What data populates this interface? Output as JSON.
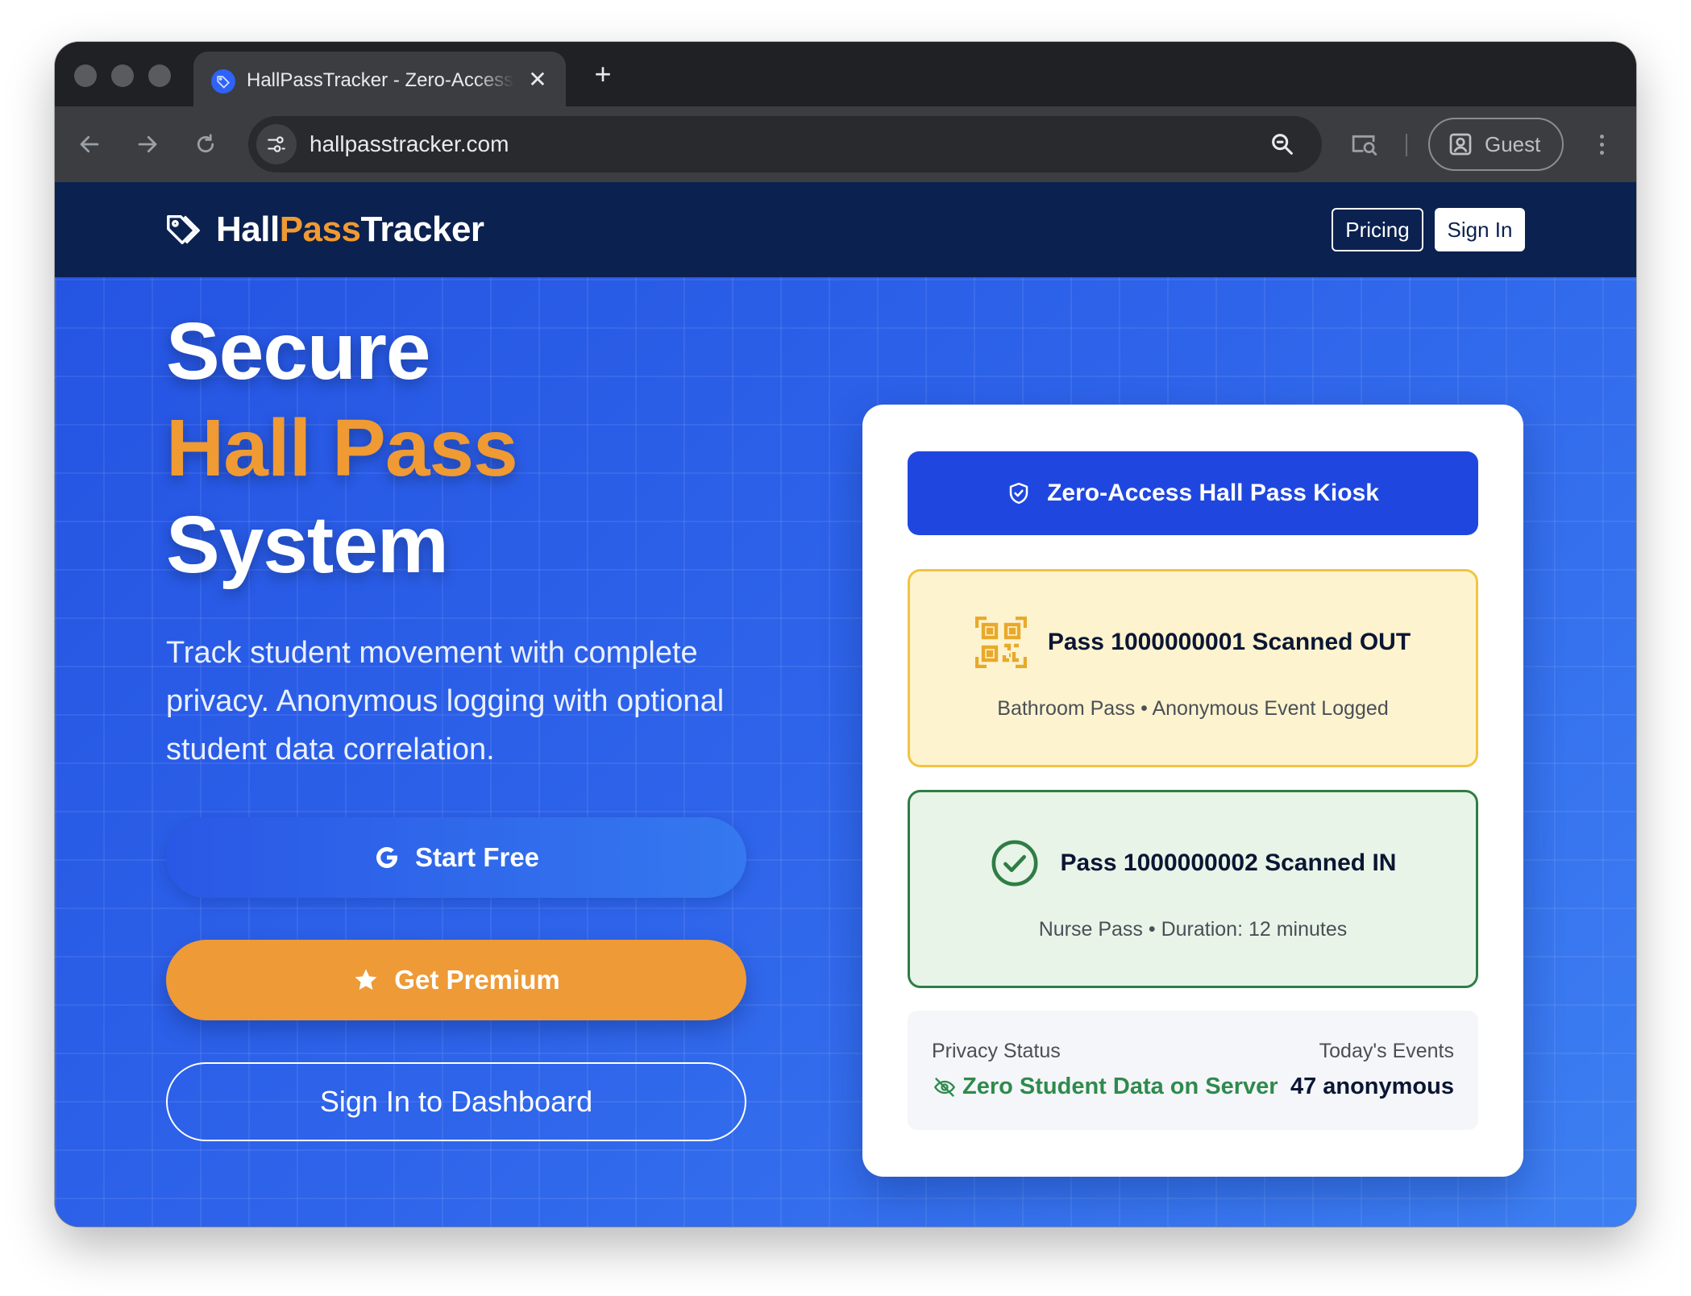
{
  "browser": {
    "tab_title": "HallPassTracker - Zero-Access Hall Pass Kiosk",
    "tab_close_symbol": "✕",
    "new_tab_symbol": "+",
    "url": "hallpasstracker.com",
    "profile_label": "Guest",
    "icons": [
      "back-arrow-icon",
      "forward-arrow-icon",
      "reload-icon",
      "site-info-icon",
      "zoom-search-icon",
      "cast-icon",
      "profile-icon",
      "more-menu-icon"
    ]
  },
  "header": {
    "logo_part1": "Hall",
    "logo_part2": "Pass",
    "logo_part3": "Tracker",
    "pricing_label": "Pricing",
    "signin_label": "Sign In"
  },
  "hero": {
    "title_line1": "Secure",
    "title_line2": "Hall Pass",
    "title_line3": "System",
    "description": "Track student movement with complete privacy. Anonymous logging with optional student data correlation.",
    "start_label": "Start Free",
    "premium_label": "Get Premium",
    "dashboard_label": "Sign In to Dashboard"
  },
  "kiosk": {
    "title": "Zero-Access Hall Pass Kiosk",
    "events": [
      {
        "title": "Pass 1000000001 Scanned OUT",
        "subtitle": "Bathroom Pass • Anonymous Event Logged",
        "icon": "qr-code-icon"
      },
      {
        "title": "Pass 1000000002 Scanned IN",
        "subtitle": "Nurse Pass • Duration: 12 minutes",
        "icon": "check-circle-icon"
      }
    ],
    "privacy_label": "Privacy Status",
    "privacy_value": "Zero Student Data on Server",
    "events_label": "Today's Events",
    "events_value": "47 anonymous"
  },
  "colors": {
    "header_navy": "#0b2150",
    "hero_blue": "#2e64ea",
    "accent_orange": "#ee9a37",
    "kiosk_blue": "#1f47e0",
    "success_green": "#2f8a4c",
    "warning_yellow": "#f1c442"
  }
}
